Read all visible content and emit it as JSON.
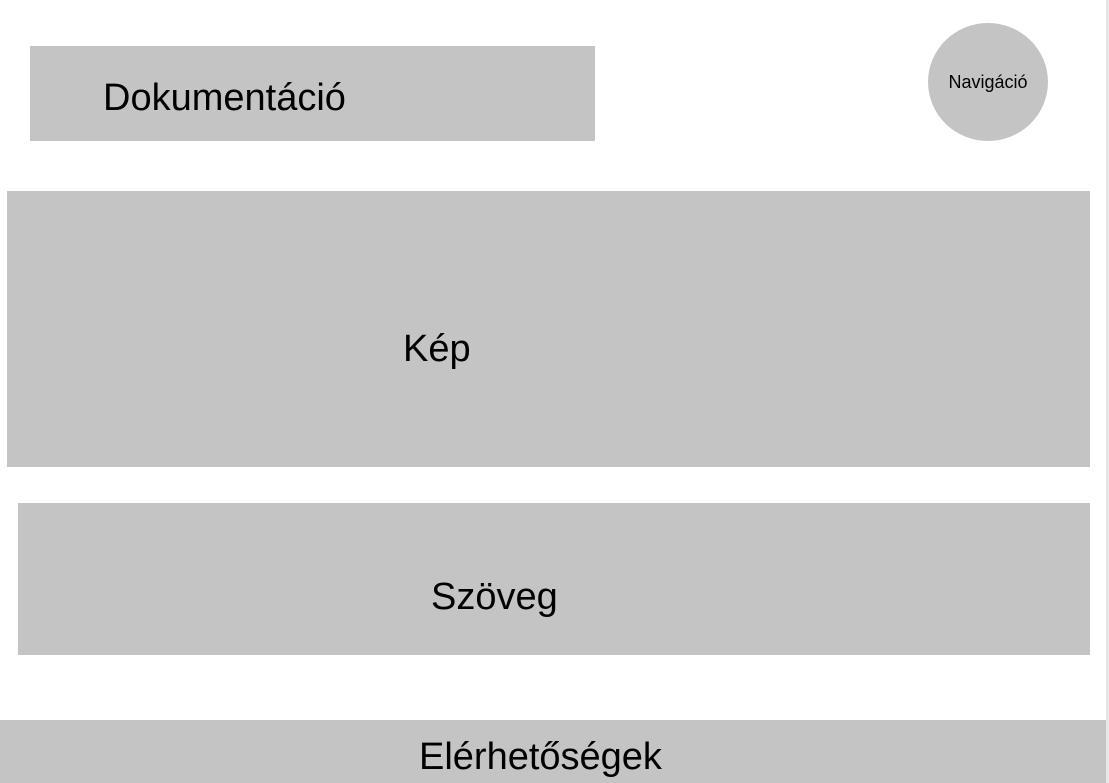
{
  "header": {
    "title": "Dokumentáció"
  },
  "navigation": {
    "label": "Navigáció"
  },
  "main": {
    "image_placeholder": "Kép",
    "text_placeholder": "Szöveg"
  },
  "footer": {
    "contacts_label": "Elérhetőségek"
  },
  "colors": {
    "placeholder_fill": "#c4c4c4",
    "background": "#ffffff",
    "text": "#000000"
  }
}
